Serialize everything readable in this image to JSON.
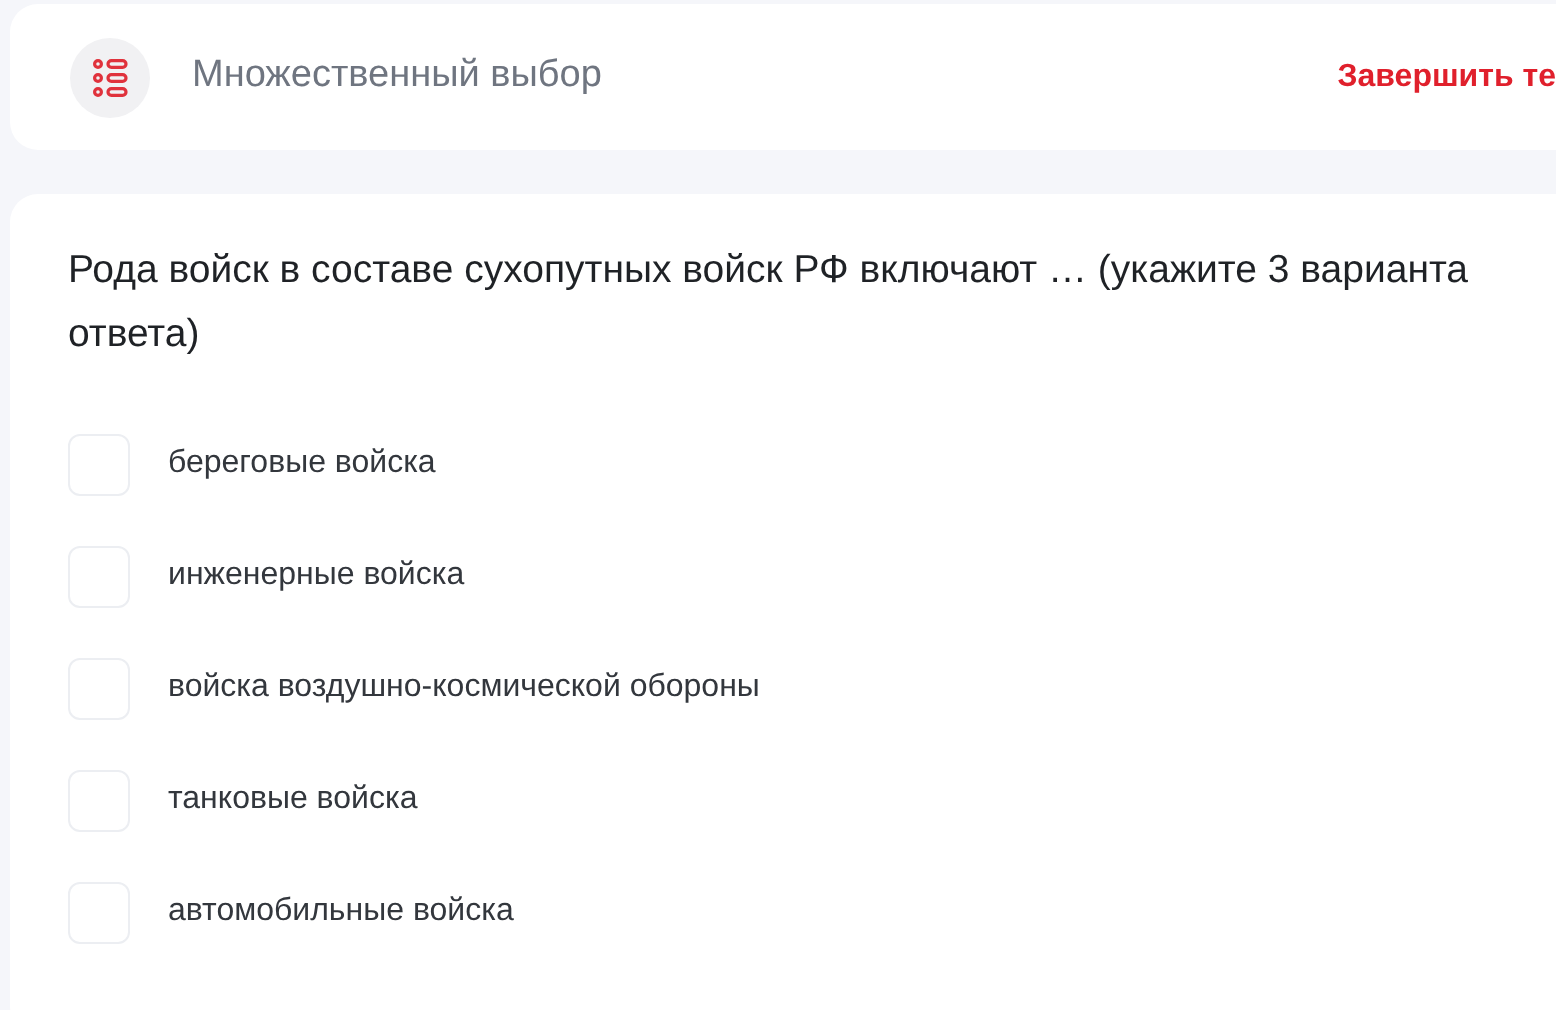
{
  "header": {
    "title": "Множественный выбор",
    "finish_button": "Завершить те"
  },
  "question": {
    "text": "Рода войск в составе сухопутных войск РФ включают … (укажите 3 варианта ответа)",
    "options": [
      {
        "label": "береговые войска",
        "checked": false
      },
      {
        "label": "инженерные войска",
        "checked": false
      },
      {
        "label": "войска воздушно-космической обороны",
        "checked": false
      },
      {
        "label": "танковые войска",
        "checked": false
      },
      {
        "label": "автомобильные войска",
        "checked": false
      }
    ]
  }
}
